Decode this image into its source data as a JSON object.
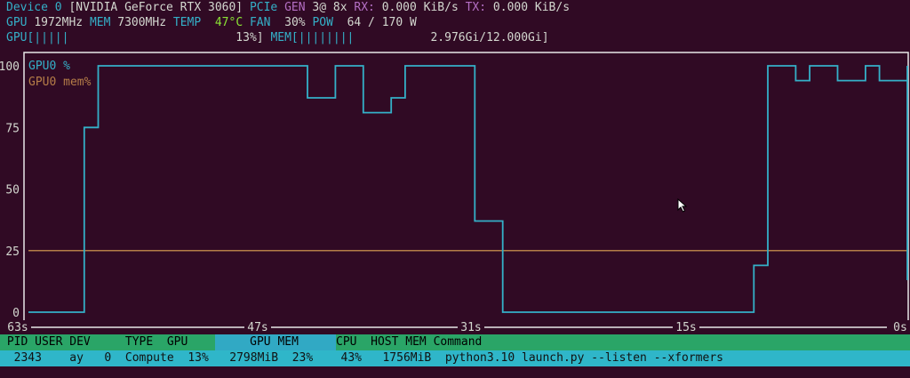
{
  "device": {
    "label": "Device 0",
    "name": "[NVIDIA GeForce RTX 3060]",
    "pcie_label": "PCIe",
    "gen_label": "GEN",
    "gen_value": "3@ 8x",
    "rx_label": "RX:",
    "rx_value": "0.000 KiB/s",
    "tx_label": "TX:",
    "tx_value": "0.000 KiB/s"
  },
  "stats": {
    "gpu_label": "GPU",
    "gpu_clock": "1972MHz",
    "mem_label": "MEM",
    "mem_clock": "7300MHz",
    "temp_label": "TEMP",
    "temp_value": "47°C",
    "fan_label": "FAN",
    "fan_value": "30%",
    "pow_label": "POW",
    "pow_value": "64 / 170 W"
  },
  "meters": {
    "gpu_label": "GPU",
    "gpu_bar": "[|||||",
    "gpu_value": "13%]",
    "mem_label": "MEM",
    "mem_bar": "[||||||||",
    "mem_value": "2.976Gi/12.000Gi]"
  },
  "chart_data": {
    "type": "line",
    "legend": [
      "GPU0 %",
      "GPU0 mem%"
    ],
    "y_ticks": [
      "100",
      "75",
      "50",
      "25",
      "0"
    ],
    "x_ticks": [
      "63s",
      "47s",
      "31s",
      "15s",
      "0s"
    ],
    "ylim": [
      0,
      100
    ],
    "xlim": [
      -63,
      0
    ],
    "colors": {
      "gpu": "#34b0c8",
      "mem": "#b57d48",
      "frame": "#e8e8e8"
    },
    "series": [
      {
        "name": "GPU0 %",
        "x": [
          -63,
          -59,
          -58,
          -56,
          -43,
          -41,
          -39,
          -37,
          -36,
          -34,
          -31,
          -29,
          -27,
          -11,
          -10,
          -8,
          -7,
          -5,
          -3,
          -2,
          0,
          1
        ],
        "y": [
          0,
          75,
          100,
          100,
          87,
          100,
          81,
          87,
          100,
          100,
          37,
          0,
          0,
          19,
          100,
          94,
          100,
          94,
          100,
          94,
          100,
          13
        ]
      },
      {
        "name": "GPU0 mem%",
        "x": [
          -63,
          0
        ],
        "y": [
          25,
          25
        ]
      }
    ]
  },
  "processes": {
    "header_a": " PID USER DEV     TYPE  GPU  ",
    "header_b": "     GPU MEM    ",
    "header_c": "CPU  HOST MEM Command",
    "row": "  2343    ay   0  Compute  13%   2798MiB  23%    43%   1756MiB  python3.10 launch.py --listen --xformers"
  }
}
